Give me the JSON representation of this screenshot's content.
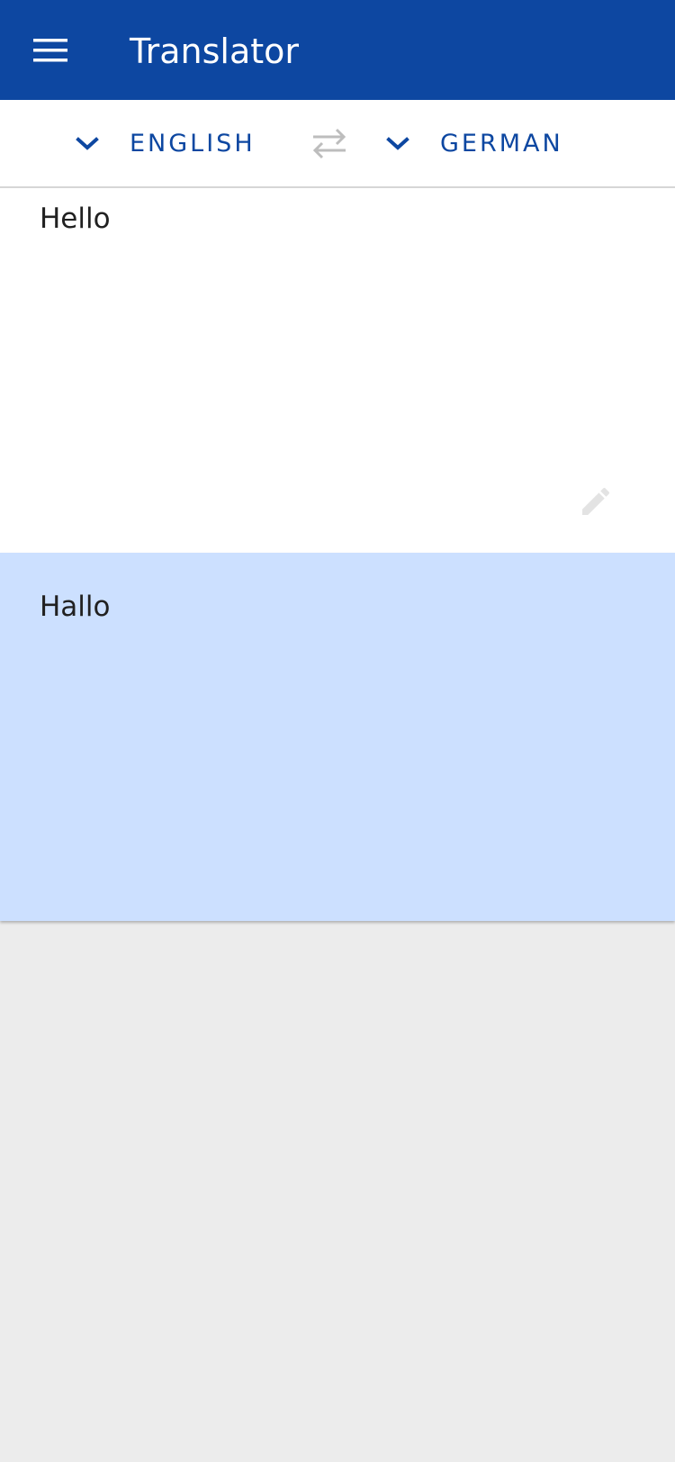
{
  "app": {
    "title": "Translator",
    "colors": {
      "primary": "#0d47a1",
      "result_background": "#cce0ff",
      "page_background": "#ececec"
    }
  },
  "toolbar": {
    "menu_icon": "hamburger-menu-icon"
  },
  "languages": {
    "source": {
      "label": "ENGLISH",
      "icon": "chevron-down-icon"
    },
    "target": {
      "label": "GERMAN",
      "icon": "chevron-down-icon"
    },
    "swap_icon": "swap-arrows-icon"
  },
  "input": {
    "text": "Hello",
    "edit_icon": "pencil-icon"
  },
  "output": {
    "text": "Hallo"
  }
}
